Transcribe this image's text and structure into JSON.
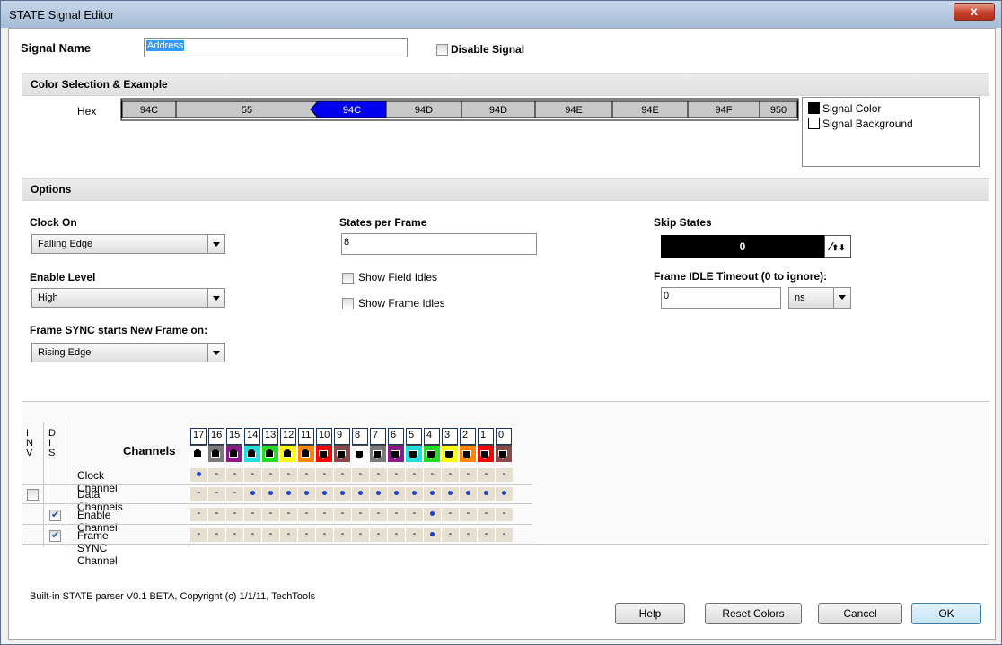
{
  "window": {
    "title": "STATE Signal Editor",
    "close_label": "x"
  },
  "signal": {
    "name_label": "Signal Name",
    "name_value": "Address",
    "disable_label": "Disable Signal",
    "disable_checked": false
  },
  "color_section": {
    "title": "Color Selection & Example",
    "hex_label": "Hex",
    "segments": [
      "94C",
      "55",
      "94C",
      "94D",
      "94D",
      "94E",
      "94E",
      "94F",
      "950"
    ],
    "highlight_color": "#0000ee",
    "legend": [
      "Signal Color",
      "Signal Background"
    ]
  },
  "options": {
    "title": "Options",
    "clock_on": {
      "label": "Clock On",
      "value": "Falling Edge"
    },
    "enable_level": {
      "label": "Enable Level",
      "value": "High"
    },
    "frame_sync": {
      "label": "Frame SYNC starts New Frame on:",
      "value": "Rising Edge"
    },
    "states_per_frame": {
      "label": "States per Frame",
      "value": "8"
    },
    "show_field_idles": "Show Field Idles",
    "show_frame_idles": "Show Frame Idles",
    "skip_states": {
      "label": "Skip States",
      "value": "0"
    },
    "frame_idle_timeout": {
      "label": "Frame IDLE Timeout (0 to ignore):",
      "value": "0",
      "unit": "ns"
    }
  },
  "channels": {
    "inv_header": [
      "I",
      "N",
      "V"
    ],
    "dis_header": [
      "D",
      "I",
      "S"
    ],
    "title": "Channels",
    "numbers": [
      "17",
      "16",
      "15",
      "14",
      "13",
      "12",
      "11",
      "10",
      "9",
      "8",
      "7",
      "6",
      "5",
      "4",
      "3",
      "2",
      "1",
      "0"
    ],
    "colors": [
      "#ffffff",
      "#7a7a7a",
      "#8b1a8b",
      "#22e0e0",
      "#22dd22",
      "#ffff00",
      "#ff8800",
      "#ff0000",
      "#8b4a4a",
      "#ffffff",
      "#7a7a7a",
      "#8b1a8b",
      "#22e0e0",
      "#22dd22",
      "#ffff00",
      "#ff8800",
      "#ff0000",
      "#8b4a4a"
    ],
    "arrows": [
      "up",
      "up",
      "up",
      "up",
      "up",
      "up",
      "up",
      "dn",
      "dn",
      "dn",
      "dn",
      "dn",
      "dn",
      "dn",
      "dn",
      "dn",
      "dn",
      "dn"
    ],
    "rows": [
      {
        "label": "Clock Channel",
        "inv": null,
        "dis": null,
        "cells": [
          "dot",
          "-",
          "-",
          "-",
          "-",
          "-",
          "-",
          "-",
          "-",
          "-",
          "-",
          "-",
          "-",
          "-",
          "-",
          "-",
          "-",
          "-"
        ]
      },
      {
        "label": "Data Channels",
        "inv": false,
        "dis": null,
        "cells": [
          "-",
          "-",
          "-",
          "dot",
          "dot",
          "dot",
          "dot",
          "dot",
          "dot",
          "dot",
          "dot",
          "dot",
          "dot",
          "dot",
          "dot",
          "dot",
          "dot",
          "dot"
        ]
      },
      {
        "label": "Enable Channel",
        "inv": null,
        "dis": true,
        "cells": [
          "-",
          "-",
          "-",
          "-",
          "-",
          "-",
          "-",
          "-",
          "-",
          "-",
          "-",
          "-",
          "-",
          "dot",
          "-",
          "-",
          "-",
          "-"
        ]
      },
      {
        "label": "Frame SYNC Channel",
        "inv": null,
        "dis": true,
        "cells": [
          "-",
          "-",
          "-",
          "-",
          "-",
          "-",
          "-",
          "-",
          "-",
          "-",
          "-",
          "-",
          "-",
          "dot",
          "-",
          "-",
          "-",
          "-"
        ]
      }
    ]
  },
  "footer": {
    "copyright": "Built-in STATE parser V0.1 BETA, Copyright (c) 1/1/11, TechTools",
    "help": "Help",
    "reset": "Reset Colors",
    "cancel": "Cancel",
    "ok": "OK"
  }
}
